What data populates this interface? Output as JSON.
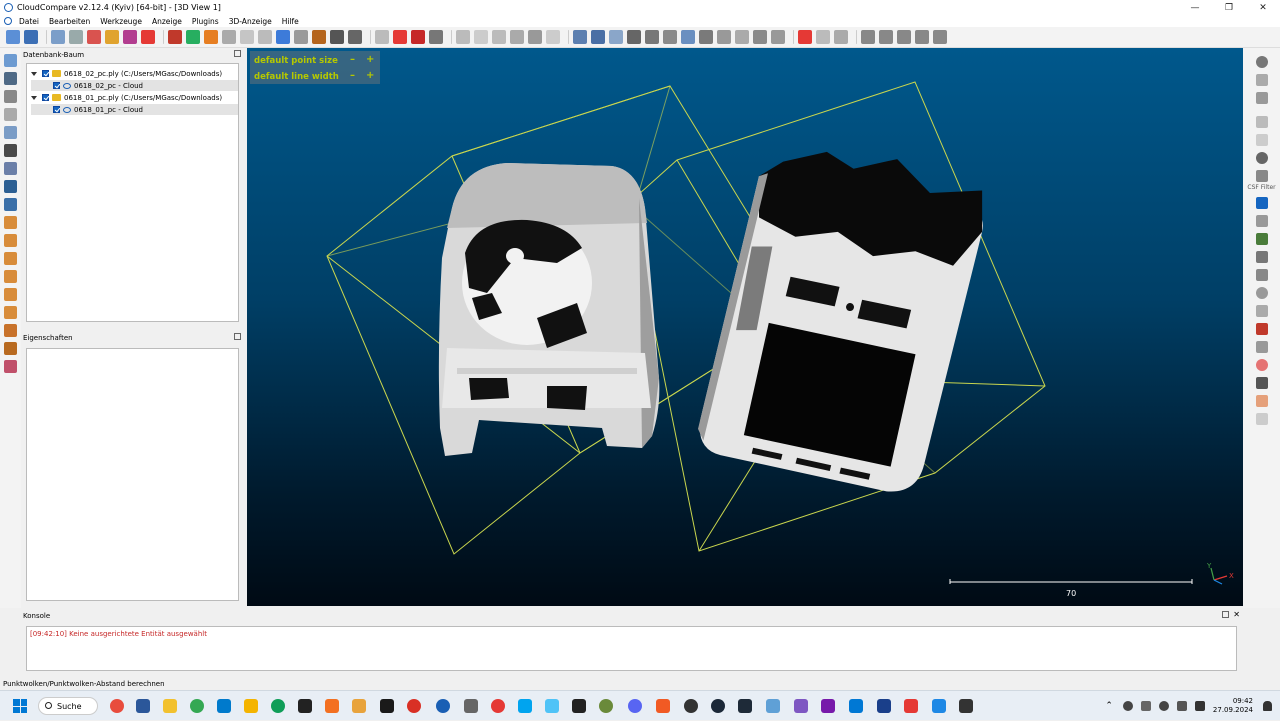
{
  "window": {
    "title": "CloudCompare v2.12.4 (Kyiv) [64-bit] - [3D View 1]",
    "controls": [
      "—",
      "❐",
      "✕"
    ]
  },
  "menu": [
    "Datei",
    "Bearbeiten",
    "Werkzeuge",
    "Anzeige",
    "Plugins",
    "3D-Anzeige",
    "Hilfe"
  ],
  "db_tree": {
    "title": "Datenbank-Baum",
    "items": [
      {
        "label": "0618_02_pc.ply (C:/Users/MGasc/Downloads)",
        "level": 0
      },
      {
        "label": "0618_02_pc - Cloud",
        "level": 1
      },
      {
        "label": "0618_01_pc.ply (C:/Users/MGasc/Downloads)",
        "level": 0
      },
      {
        "label": "0618_01_pc - Cloud",
        "level": 1
      }
    ]
  },
  "properties": {
    "title": "Eigenschaften"
  },
  "view3d": {
    "params": [
      {
        "label": "default point size",
        "minus": "–",
        "plus": "+"
      },
      {
        "label": "default line width",
        "minus": "–",
        "plus": "+"
      }
    ],
    "scale_value": "70",
    "bbox_color": "#d4e05a",
    "axis_colors": {
      "x": "#e53935",
      "y": "#43a047",
      "z": "#1e88e5"
    }
  },
  "right_tools": {
    "csf_label": "CSF Filter"
  },
  "console": {
    "title": "Konsole",
    "lines": [
      "[09:42:10] Keine ausgerichtete Entität ausgewählt"
    ]
  },
  "status": "Punktwolken/Punktwolken-Abstand berechnen",
  "taskbar": {
    "search": "Suche",
    "time": "09:42",
    "date": "27.09.2024"
  }
}
